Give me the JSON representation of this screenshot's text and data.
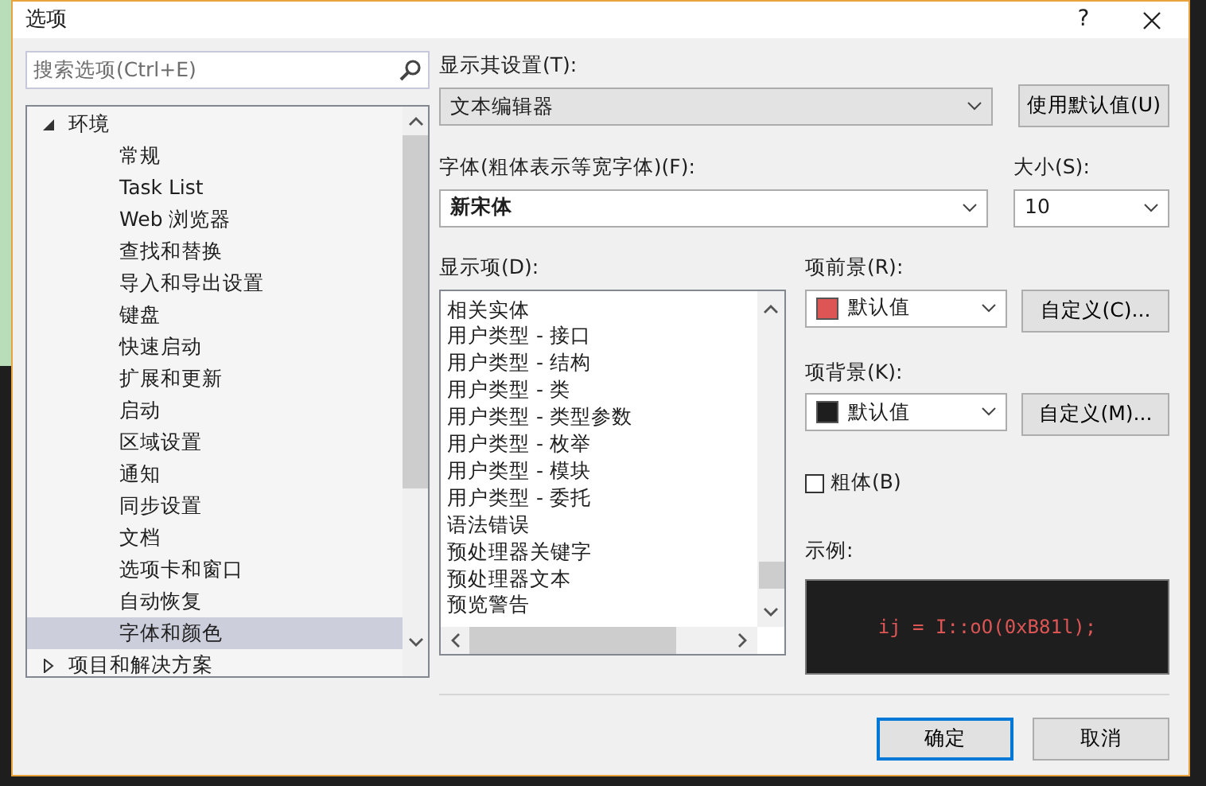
{
  "window": {
    "title": "选项",
    "help": "?"
  },
  "search": {
    "placeholder": "搜索选项(Ctrl+E)"
  },
  "tree": [
    {
      "label": "环境",
      "expanded": true,
      "selected": false,
      "children": [
        {
          "label": "常规",
          "selected": false
        },
        {
          "label": "Task List",
          "selected": false
        },
        {
          "label": "Web 浏览器",
          "selected": false
        },
        {
          "label": "查找和替换",
          "selected": false
        },
        {
          "label": "导入和导出设置",
          "selected": false
        },
        {
          "label": "键盘",
          "selected": false
        },
        {
          "label": "快速启动",
          "selected": false
        },
        {
          "label": "扩展和更新",
          "selected": false
        },
        {
          "label": "启动",
          "selected": false
        },
        {
          "label": "区域设置",
          "selected": false
        },
        {
          "label": "通知",
          "selected": false
        },
        {
          "label": "同步设置",
          "selected": false
        },
        {
          "label": "文档",
          "selected": false
        },
        {
          "label": "选项卡和窗口",
          "selected": false
        },
        {
          "label": "自动恢复",
          "selected": false
        },
        {
          "label": "字体和颜色",
          "selected": true
        }
      ]
    },
    {
      "label": "项目和解决方案",
      "expanded": false,
      "selected": false
    }
  ],
  "show_settings_for": {
    "label": "显示其设置(T):",
    "value": "文本编辑器"
  },
  "use_defaults_button": "使用默认值(U)",
  "font": {
    "label": "字体(粗体表示等宽字体)(F):",
    "value": "新宋体"
  },
  "size": {
    "label": "大小(S):",
    "value": "10"
  },
  "display_items": {
    "label": "显示项(D):",
    "items": [
      "相关实体",
      "用户类型 - 接口",
      "用户类型 - 结构",
      "用户类型 - 类",
      "用户类型 - 类型参数",
      "用户类型 - 枚举",
      "用户类型 - 模块",
      "用户类型 - 委托",
      "语法错误",
      "预处理器关键字",
      "预处理器文本",
      "预览警告"
    ]
  },
  "item_foreground": {
    "label": "项前景(R):",
    "value": "默认值",
    "color": "#dd5555",
    "button": "自定义(C)..."
  },
  "item_background": {
    "label": "项背景(K):",
    "value": "默认值",
    "color": "#1e1e1e",
    "button": "自定义(M)..."
  },
  "bold": {
    "label": "粗体(B)",
    "checked": false
  },
  "sample": {
    "label": "示例:",
    "text": "ij = I::oO(0xB81l);"
  },
  "buttons": [
    {
      "label": "确定",
      "default": true
    },
    {
      "label": "取消",
      "default": false
    }
  ]
}
